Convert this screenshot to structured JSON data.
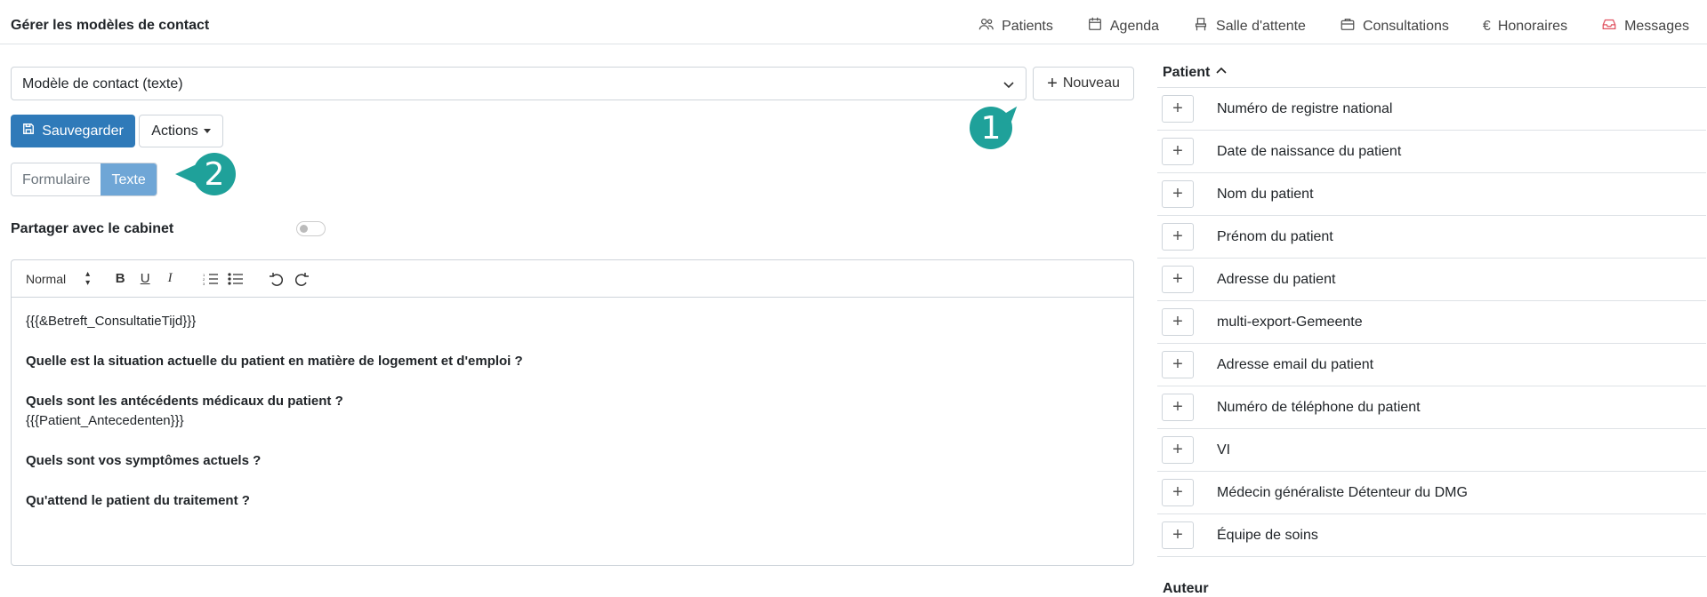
{
  "page_title": "Gérer les modèles de contact",
  "nav": [
    {
      "label": "Patients",
      "icon": "users-icon"
    },
    {
      "label": "Agenda",
      "icon": "calendar-icon"
    },
    {
      "label": "Salle d'attente",
      "icon": "chair-icon"
    },
    {
      "label": "Consultations",
      "icon": "briefcase-icon"
    },
    {
      "label": "Honoraires",
      "icon": "euro-icon"
    },
    {
      "label": "Messages",
      "icon": "inbox-icon"
    }
  ],
  "template_select": {
    "value": "Modèle de contact (texte)"
  },
  "buttons": {
    "new": "Nouveau",
    "save": "Sauvegarder",
    "actions": "Actions"
  },
  "view_toggle": {
    "form": "Formulaire",
    "text": "Texte",
    "active": "text"
  },
  "share": {
    "label": "Partager avec le cabinet",
    "enabled": false
  },
  "toolbar": {
    "format": "Normal"
  },
  "content": {
    "line1": "{{{&Betreft_ConsultatieTijd}}}",
    "q1": "Quelle est la situation actuelle du patient en matière de logement et d'emploi ?",
    "q2": "Quels sont les antécédents médicaux du patient ?",
    "line2": "{{{Patient_Antecedenten}}}",
    "q3": "Quels sont vos symptômes actuels ?",
    "q4": "Qu'attend le patient du traitement ?"
  },
  "right_panel": {
    "section_title": "Patient",
    "fields": [
      "Numéro de registre national",
      "Date de naissance du patient",
      "Nom du patient",
      "Prénom du patient",
      "Adresse du patient",
      "multi-export-Gemeente",
      "Adresse email du patient",
      "Numéro de téléphone du patient",
      "VI",
      "Médecin généraliste Détenteur du DMG",
      "Équipe de soins"
    ],
    "next_section_title": "Auteur"
  },
  "badges": {
    "one": "1",
    "two": "2"
  },
  "colors": {
    "primary": "#2f7ab9",
    "toggle_active": "#6fa6d6",
    "badge": "#1fa19a",
    "messages_icon": "#e05260"
  }
}
